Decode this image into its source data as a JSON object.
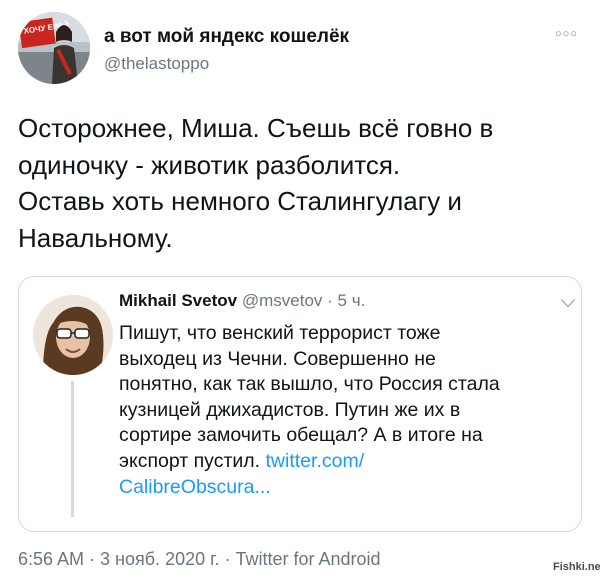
{
  "author": {
    "display_name": "а вот мой яндекс кошелёк",
    "handle": "@thelastoppo",
    "avatar_poster_text": "ХОЧУ ЕРАЙ"
  },
  "more_icon": "more-dots-icon",
  "tweet": {
    "lines": [
      "Осторожнее, Миша. Съешь всё говно в",
      "одиночку - животик разболится.",
      "Оставь хоть немного Сталингулагу и",
      "Навальному."
    ]
  },
  "quoted": {
    "name": "Mikhail Svetov",
    "handle": "@msvetov",
    "separator": "·",
    "time": "5 ч.",
    "lines": [
      "Пишут, что венский террорист тоже",
      "выходец из Чечни. Совершенно не",
      "понятно, как так вышло, что Россия стала",
      "кузницей джихадистов. Путин же их в",
      "сортире замочить обещал? А в итоге на"
    ],
    "line6_text": "экспорт пустил.",
    "link_part1": "twitter.com/",
    "link_part2": "CalibreObscura..."
  },
  "timestamp": "6:56 AM · 3 нояб. 2020 г. · Twitter for Android",
  "watermark": "Fishki.net",
  "colors": {
    "text": "#0f1419",
    "secondary": "#6b7680",
    "link": "#1d9bf0",
    "border": "#cfd9de"
  }
}
